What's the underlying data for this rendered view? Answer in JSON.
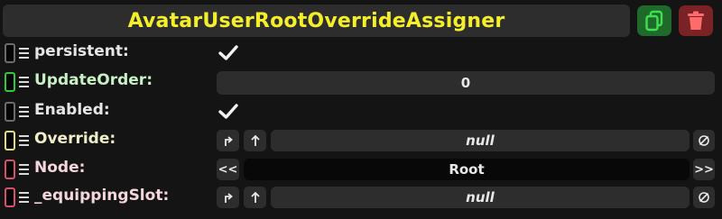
{
  "header": {
    "title": "AvatarUserRootOverrideAssigner",
    "duplicate_icon": "duplicate-icon",
    "delete_icon": "trash-icon",
    "colors": {
      "title": "#f5ee2a",
      "duplicate_bg": "#1f6a2a",
      "delete_bg": "#7a2226"
    }
  },
  "fields": [
    {
      "label": "persistent:",
      "type": "checkbox",
      "checked": true,
      "indicator_color": "#6b6b6b"
    },
    {
      "label": "UpdateOrder:",
      "type": "number",
      "value": "0",
      "indicator_color": "#2fc93a"
    },
    {
      "label": "Enabled:",
      "type": "checkbox",
      "checked": true,
      "indicator_color": "#6b6b6b"
    },
    {
      "label": "Override:",
      "type": "reference",
      "value": "null",
      "indicator_color": "#e5e07a"
    },
    {
      "label": "Node:",
      "type": "enum",
      "value": "Root",
      "prev": "<<",
      "next": ">>",
      "indicator_color": "#d9506b"
    },
    {
      "label": "_equippingSlot:",
      "type": "reference",
      "value": "null",
      "indicator_color": "#d9506b"
    }
  ]
}
